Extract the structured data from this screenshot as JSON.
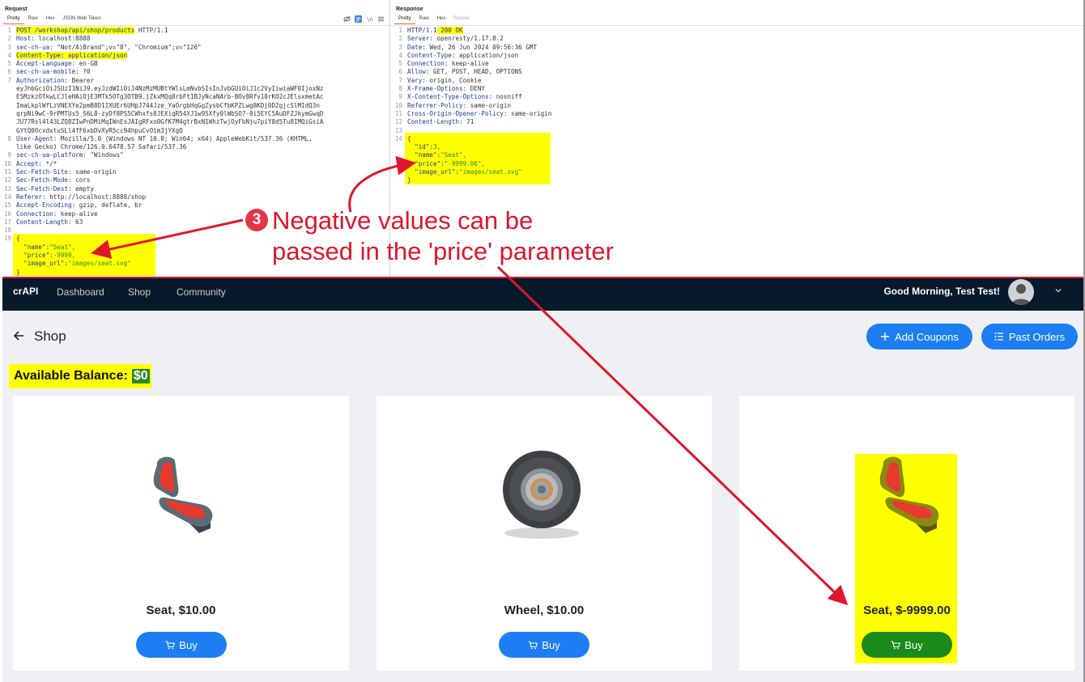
{
  "request": {
    "title": "Request",
    "tabs": [
      "Pretty",
      "Raw",
      "Hex",
      "JSON Web Token"
    ],
    "lines": [
      {
        "n": "1",
        "k": "POST /workshop/api/shop/products",
        "v": " HTTP/1.1"
      },
      {
        "n": "2",
        "k": "Host:",
        "v": " localhost:8888"
      },
      {
        "n": "3",
        "k": "sec-ch-ua:",
        "v": " \"Not/A)Brand\";v=\"8\", \"Chromium\";v=\"126\""
      },
      {
        "n": "4",
        "k": "Content-Type: application/json",
        "v": ""
      },
      {
        "n": "5",
        "k": "Accept-Language:",
        "v": " en-GB"
      },
      {
        "n": "6",
        "k": "sec-ch-ua-mobile:",
        "v": " ?0"
      },
      {
        "n": "7",
        "k": "Authorization:",
        "v": " Bearer"
      },
      {
        "n": "",
        "k": "",
        "v": "eyJhbGciOiJSUzI1NiJ9.eyJzdWIiOiJ4NzMzMUBtYWlsLmNvbSIsInJvbGUiOiJ1c2VyIiwiaWF0IjoxNz"
      },
      {
        "n": "",
        "k": "",
        "v": "E5MzkzOTkwLCJleHAiOjE3MTk5OTg3OTB9.jZkxMQq8rbFt1BJyNcaNArb-BOv8Rfv18rKO2cJElsxmetAc"
      },
      {
        "n": "",
        "k": "",
        "v": "ImaLkplWfLzVNEXYe2pmB8D1IXUEr6UHpJ744Jze_YaOrgbHqGgZysbCfbKPZLwg8KDj0D2gjcSlMIdQ3n"
      },
      {
        "n": "",
        "k": "",
        "v": "qrpNi9wC-9rPMTUs5_S6L8-zyDf8PS5CWhxfs8JEXiqR54XJ1w95Xfy0lWbSO7-0i5EYC5AuDFZJkymGwqD"
      },
      {
        "n": "",
        "k": "",
        "v": "JU77Rsl4l43LZQ8ZIwPnDMiMqIWnEsJAIgRFxo0GfK7M4gtrBxN1WhzTwjOyFbNju7piY8d5Tu8IMQiGsiA"
      },
      {
        "n": "",
        "k": "",
        "v": "GYtQ0OcxdxtuSLl4fF6xbDvXyR5cc94hpuCvOim3jYXgQ"
      },
      {
        "n": "8",
        "k": "User-Agent:",
        "v": " Mozilla/5.0 (Windows NT 10.0; Win64; x64) AppleWebKit/537.36 (KHTML,"
      },
      {
        "n": "",
        "k": "",
        "v": "like Gecko) Chrome/126.0.6478.57 Safari/537.36"
      },
      {
        "n": "9",
        "k": "sec-ch-ua-platform:",
        "v": " \"Windows\""
      },
      {
        "n": "10",
        "k": "Accept:",
        "v": " */*"
      },
      {
        "n": "11",
        "k": "Sec-Fetch-Site:",
        "v": " same-origin"
      },
      {
        "n": "12",
        "k": "Sec-Fetch-Mode:",
        "v": " cors"
      },
      {
        "n": "13",
        "k": "Sec-Fetch-Dest:",
        "v": " empty"
      },
      {
        "n": "14",
        "k": "Referer:",
        "v": " http://localhost:8888/shop"
      },
      {
        "n": "15",
        "k": "Accept-Encoding:",
        "v": " gzip, deflate, br"
      },
      {
        "n": "16",
        "k": "Connection:",
        "v": " keep-alive"
      },
      {
        "n": "17",
        "k": "Content-Length:",
        "v": " 63"
      },
      {
        "n": "18",
        "k": "",
        "v": ""
      },
      {
        "n": "19",
        "k": "",
        "v": "{"
      },
      {
        "n": "",
        "k": "  \"name\":",
        "v": "\"Seat\","
      },
      {
        "n": "",
        "k": "  \"price\":",
        "v": "-9999,"
      },
      {
        "n": "",
        "k": "  \"image_url\":",
        "v": "\"images/seat.svg\""
      },
      {
        "n": "",
        "k": "",
        "v": "}"
      }
    ]
  },
  "response": {
    "title": "Response",
    "tabs": [
      "Pretty",
      "Raw",
      "Hex",
      "Render"
    ],
    "lines": [
      {
        "n": "1",
        "k": "HTTP/1.1",
        "v": " 200 OK"
      },
      {
        "n": "2",
        "k": "Server:",
        "v": " openresty/1.17.8.2"
      },
      {
        "n": "3",
        "k": "Date:",
        "v": " Wed, 26 Jun 2024 09:56:36 GMT"
      },
      {
        "n": "4",
        "k": "Content-Type:",
        "v": " application/json"
      },
      {
        "n": "5",
        "k": "Connection:",
        "v": " keep-alive"
      },
      {
        "n": "6",
        "k": "Allow:",
        "v": " GET, POST, HEAD, OPTIONS"
      },
      {
        "n": "7",
        "k": "Vary:",
        "v": " origin, Cookie"
      },
      {
        "n": "8",
        "k": "X-Frame-Options:",
        "v": " DENY"
      },
      {
        "n": "9",
        "k": "X-Content-Type-Options:",
        "v": " nosniff"
      },
      {
        "n": "10",
        "k": "Referrer-Policy:",
        "v": " same-origin"
      },
      {
        "n": "11",
        "k": "Cross-Origin-Opener-Policy:",
        "v": " same-origin"
      },
      {
        "n": "12",
        "k": "Content-Length:",
        "v": " 71"
      },
      {
        "n": "13",
        "k": "",
        "v": ""
      },
      {
        "n": "14",
        "k": "",
        "v": "{"
      },
      {
        "n": "",
        "k": "  \"id\":",
        "v": "3,"
      },
      {
        "n": "",
        "k": "  \"name\":",
        "v": "\"Seat\","
      },
      {
        "n": "",
        "k": "  \"price\":",
        "v": "\"-9999.00\","
      },
      {
        "n": "",
        "k": "  \"image_url\":",
        "v": "\"images/seat.svg\""
      },
      {
        "n": "",
        "k": "",
        "v": "}"
      }
    ]
  },
  "annotation": {
    "number": "3",
    "line1": "Negative values can be",
    "line2": "passed in the 'price' parameter",
    "color": "#e0162b"
  },
  "app": {
    "brand": "crAPI",
    "nav": [
      "Dashboard",
      "Shop",
      "Community"
    ],
    "greeting": "Good Morning, Test Test!",
    "page_title": "Shop",
    "add_coupons": "Add Coupons",
    "past_orders": "Past Orders",
    "balance_label": "Available Balance:",
    "balance_value": "$0",
    "products": [
      {
        "title": "Seat, $10.00",
        "buy": "Buy",
        "icon": "seat-image"
      },
      {
        "title": "Wheel, $10.00",
        "buy": "Buy",
        "icon": "wheel-image"
      },
      {
        "title": "Seat, $-9999.00",
        "buy": "Buy",
        "icon": "seat-image"
      }
    ],
    "accent": "#1c7ef2",
    "highlight": "#ffff00"
  }
}
